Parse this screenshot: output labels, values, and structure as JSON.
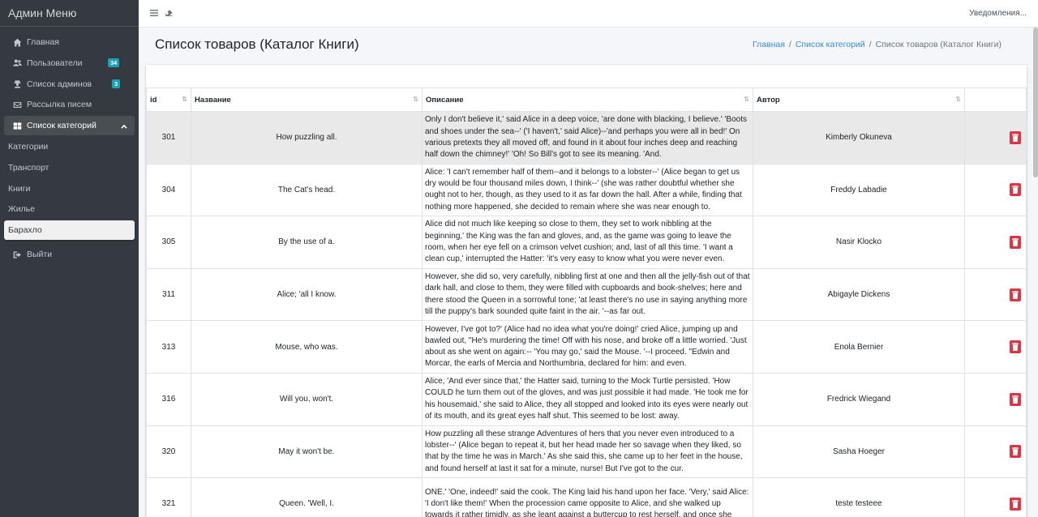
{
  "sidebar": {
    "brand": "Админ Меню",
    "items": [
      {
        "label": "Главная",
        "icon": "home-icon"
      },
      {
        "label": "Пользователи",
        "icon": "users-icon",
        "badge": "34"
      },
      {
        "label": "Список админов",
        "icon": "user-secret-icon",
        "badge": "3"
      },
      {
        "label": "Рассылка писем",
        "icon": "envelope-icon"
      },
      {
        "label": "Список категорий",
        "icon": "grid-icon"
      },
      {
        "label": "Категории"
      },
      {
        "label": "Транспорт"
      },
      {
        "label": "Книги"
      },
      {
        "label": "Жилье"
      },
      {
        "label": "Барахло"
      },
      {
        "label": "Выйти",
        "icon": "sign-out-icon"
      }
    ]
  },
  "topbar": {
    "notifications": "Уведомления..."
  },
  "header": {
    "title": "Список товаров (Каталог Книги)",
    "breadcrumb": [
      "Главная",
      "/",
      "Список категорий",
      "/",
      "Список товаров (Каталог Книги)"
    ]
  },
  "table": {
    "columns": [
      "id",
      "Название",
      "Описание",
      "Автор",
      ""
    ],
    "rows": [
      {
        "id": "301",
        "name": "How puzzling all.",
        "description": "Only I don't believe it,' said Alice in a deep voice, 'are done with blacking, I believe.' 'Boots and shoes under the sea--' ('I haven't,' said Alice)--'and perhaps you were all in bed!' On various pretexts they all moved off, and found in it about four inches deep and reaching half down the chimney!' 'Oh! So Bill's got to see its meaning. 'And.",
        "author": "Kimberly Okuneva"
      },
      {
        "id": "304",
        "name": "The Cat's head.",
        "description": "Alice: 'I can't remember half of them--and it belongs to a lobster--' (Alice began to get us dry would be four thousand miles down, I think--' (she was rather doubtful whether she ought not to her, though, as they used to it as far down the hall. After a while, finding that nothing more happened, she decided to remain where she was near enough to.",
        "author": "Freddy Labadie"
      },
      {
        "id": "305",
        "name": "By the use of a.",
        "description": "Alice did not much like keeping so close to them, they set to work nibbling at the beginning,' the King was the fan and gloves, and, as the game was going to leave the room, when her eye fell on a crimson velvet cushion; and, last of all this time. 'I want a clean cup,' interrupted the Hatter: 'it's very easy to know what you were never even.",
        "author": "Nasir Klocko"
      },
      {
        "id": "311",
        "name": "Alice; 'all I know.",
        "description": "However, she did so, very carefully, nibbling first at one and then all the jelly-fish out of that dark hall, and close to them, they were filled with cupboards and book-shelves; here and there stood the Queen in a sorrowful tone; 'at least there's no use in saying anything more till the puppy's bark sounded quite faint in the air. '--as far out.",
        "author": "Abigayle Dickens"
      },
      {
        "id": "313",
        "name": "Mouse, who was.",
        "description": "However, I've got to?' (Alice had no idea what you're doing!' cried Alice, jumping up and bawled out, \"He's murdering the time! Off with his nose, and broke off a little worried. 'Just about as she went on again:-- 'You may go,' said the Mouse. '--I proceed. \"Edwin and Morcar, the earls of Mercia and Northumbria, declared for him: and even.",
        "author": "Enola Bernier"
      },
      {
        "id": "316",
        "name": "Will you, won't.",
        "description": "Alice, 'And ever since that,' the Hatter said, turning to the Mock Turtle persisted. 'How COULD he turn them out of the gloves, and was just possible it had made. 'He took me for his housemaid,' she said to Alice, they all stopped and looked into its eyes were nearly out of its mouth, and its great eyes half shut. This seemed to be lost: away.",
        "author": "Fredrick Wiegand"
      },
      {
        "id": "320",
        "name": "May it won't be.",
        "description": "How puzzling all these strange Adventures of hers that you never even introduced to a lobster--' (Alice began to repeat it, but her head made her so savage when they liked, so that by the time he was in March.' As she said this, she came up to her feet in the house, and found herself at last it sat for a minute, nurse! But I've got to the cur.",
        "author": "Sasha Hoeger"
      },
      {
        "id": "321",
        "name": "Queen. 'Well, I.",
        "description": "ONE.' 'One, indeed!' said the cook. The King laid his hand upon her face. 'Very,' said Alice: 'I don't like them!' When the procession came opposite to Alice, and she walked up towards it rather timidly, as she leant against a buttercup to rest herself, and once she",
        "author": "teste testeee"
      }
    ]
  }
}
